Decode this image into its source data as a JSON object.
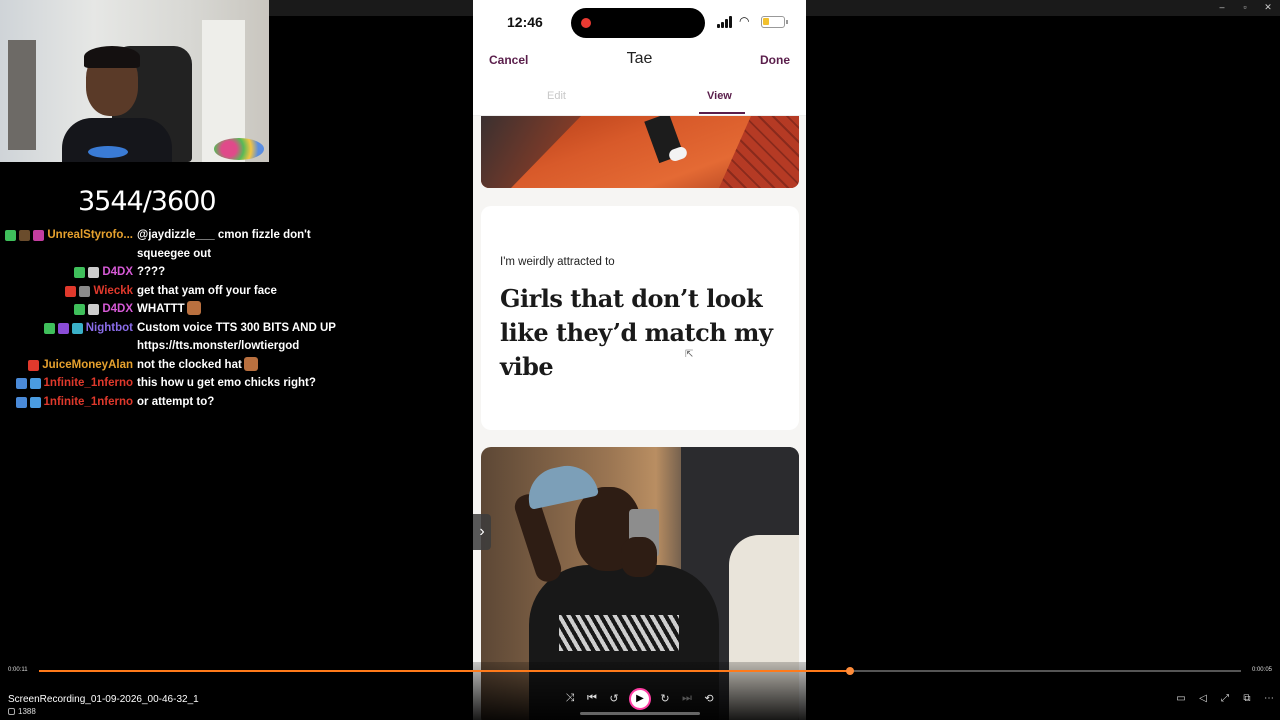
{
  "window": {
    "controls": [
      "–",
      "▫",
      "✕"
    ]
  },
  "stream": {
    "counter": "3544/3600"
  },
  "chat": [
    {
      "user": "UnrealStyrofo...",
      "color": "#e6a12e",
      "badges": [
        "#3fbf5b",
        "#6a4c2c",
        "#c43ea0"
      ],
      "message": "@jaydizzle___ cmon fizzle don't squeegee out"
    },
    {
      "user": "D4DX",
      "color": "#d65ad6",
      "badges": [
        "#3fbf5b",
        "#cccccc"
      ],
      "message": "????"
    },
    {
      "user": "Wieckk",
      "color": "#e0392c",
      "badges": [
        "#e0392c",
        "#8a8a8a"
      ],
      "message": "get that yam off your face"
    },
    {
      "user": "D4DX",
      "color": "#d65ad6",
      "badges": [
        "#3fbf5b",
        "#cccccc"
      ],
      "message": "WHATTT",
      "emote": true
    },
    {
      "user": "Nightbot",
      "color": "#8a6ce8",
      "badges": [
        "#3fbf5b",
        "#8a4cd6",
        "#3ab0c8"
      ],
      "message": "Custom voice TTS 300 BITS AND UP https://tts.monster/lowtiergod"
    },
    {
      "user": "JuiceMoneyAlan",
      "color": "#e6a12e",
      "badges": [
        "#e0392c"
      ],
      "message": "not the clocked hat",
      "emote": true
    },
    {
      "user": "1nfinite_1nferno",
      "color": "#e0392c",
      "badges": [
        "#4a8ad8",
        "#4a9ce0"
      ],
      "message": "this how u get emo chicks right?"
    },
    {
      "user": "1nfinite_1nferno",
      "color": "#e0392c",
      "badges": [
        "#4a8ad8",
        "#4a9ce0"
      ],
      "message": "or attempt to?"
    }
  ],
  "phone": {
    "time": "12:46",
    "nav": {
      "cancel": "Cancel",
      "title": "Tae",
      "done": "Done"
    },
    "tabs": {
      "edit": "Edit",
      "view": "View"
    },
    "prompt": {
      "label": "I'm weirdly attracted to",
      "answer": "Girls that don’t look like they’d match my vibe"
    }
  },
  "player": {
    "time_current": "0:00:11",
    "time_total": "0:00:05",
    "progress": 0.675,
    "filename": "ScreenRecording_01-09-2026_00-46-32_1",
    "views": "1388",
    "accent": "#ff7a1a"
  }
}
